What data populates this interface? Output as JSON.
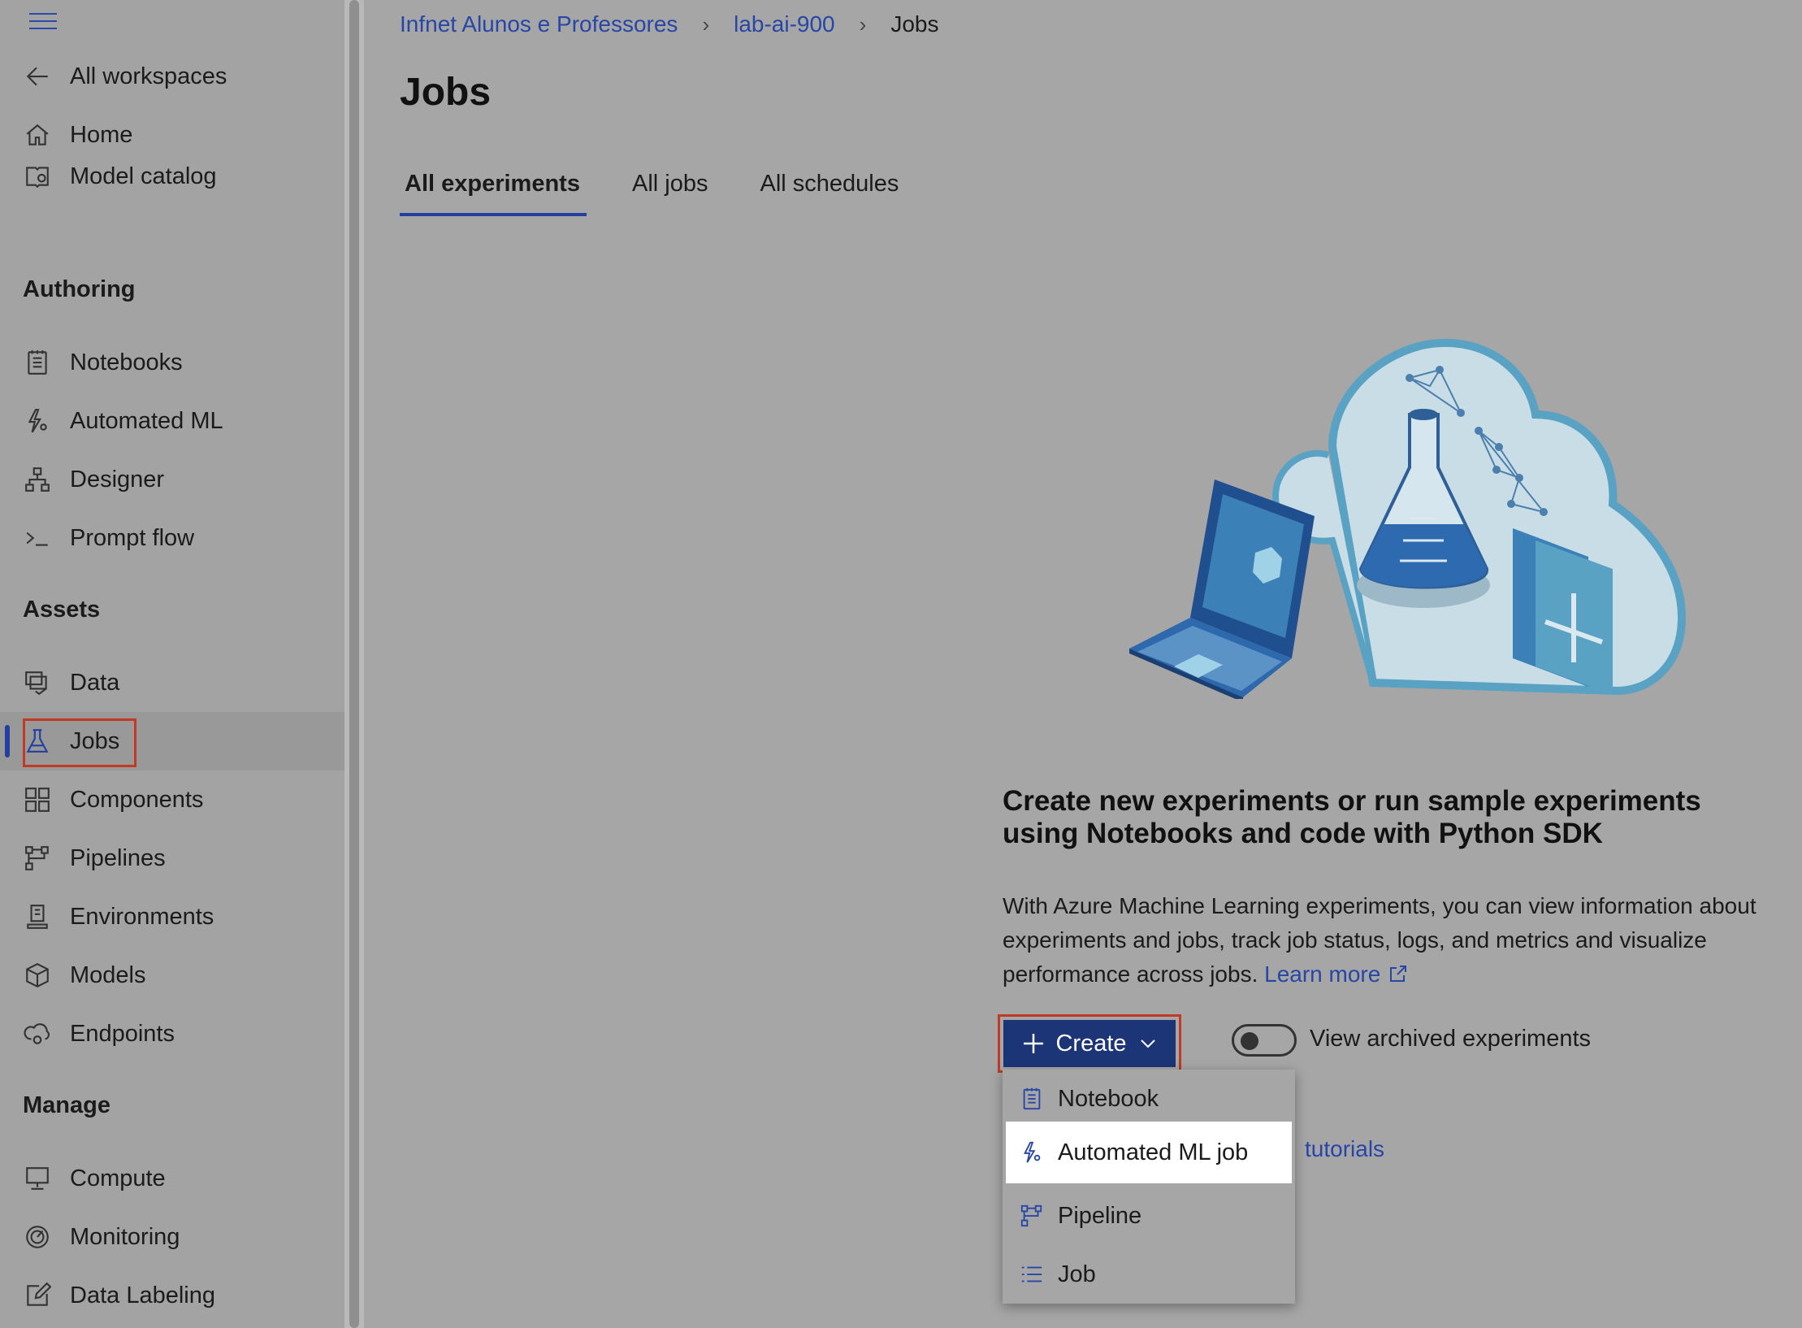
{
  "sidebar": {
    "back_label": "All workspaces",
    "items_top": [
      {
        "label": "Home",
        "icon": "home-icon"
      },
      {
        "label": "Model catalog",
        "icon": "model-catalog-icon"
      }
    ],
    "authoring_heading": "Authoring",
    "authoring_items": [
      {
        "label": "Notebooks",
        "icon": "notebook-icon"
      },
      {
        "label": "Automated ML",
        "icon": "automated-ml-icon"
      },
      {
        "label": "Designer",
        "icon": "designer-icon"
      },
      {
        "label": "Prompt flow",
        "icon": "prompt-flow-icon"
      }
    ],
    "assets_heading": "Assets",
    "assets_items": [
      {
        "label": "Data",
        "icon": "data-icon"
      },
      {
        "label": "Jobs",
        "icon": "flask-icon",
        "active": true
      },
      {
        "label": "Components",
        "icon": "components-icon"
      },
      {
        "label": "Pipelines",
        "icon": "pipeline-icon"
      },
      {
        "label": "Environments",
        "icon": "environment-icon"
      },
      {
        "label": "Models",
        "icon": "cube-icon"
      },
      {
        "label": "Endpoints",
        "icon": "endpoint-icon"
      }
    ],
    "manage_heading": "Manage",
    "manage_items": [
      {
        "label": "Compute",
        "icon": "monitor-icon"
      },
      {
        "label": "Monitoring",
        "icon": "gauge-icon"
      },
      {
        "label": "Data Labeling",
        "icon": "edit-icon"
      }
    ]
  },
  "breadcrumb": {
    "items": [
      "Infnet Alunos e Professores",
      "lab-ai-900"
    ],
    "current": "Jobs"
  },
  "page": {
    "title": "Jobs",
    "tabs": [
      "All experiments",
      "All jobs",
      "All schedules"
    ],
    "active_tab": "All experiments"
  },
  "empty_state": {
    "title": "Create new experiments or run sample experiments using Notebooks and code with Python SDK",
    "description": "With Azure Machine Learning experiments, you can view information about experiments and jobs, track job status, logs, and metrics and visualize performance across jobs.",
    "learn_more": "Learn more",
    "tutorials_link": "tutorials"
  },
  "actions": {
    "create_label": "Create",
    "toggle_label": "View archived experiments",
    "toggle_on": false
  },
  "create_menu": {
    "items": [
      {
        "label": "Notebook",
        "icon": "notebook-icon"
      },
      {
        "label": "Automated ML job",
        "icon": "automated-ml-icon",
        "highlighted": true
      },
      {
        "label": "Pipeline",
        "icon": "pipeline-icon"
      },
      {
        "label": "Job",
        "icon": "list-icon"
      }
    ]
  },
  "colors": {
    "accent": "#2340a0",
    "link": "#2746a6",
    "highlight_border": "#c03a24",
    "primary_button": "#1c3577",
    "overlay_gray": "#a6a6a6"
  }
}
